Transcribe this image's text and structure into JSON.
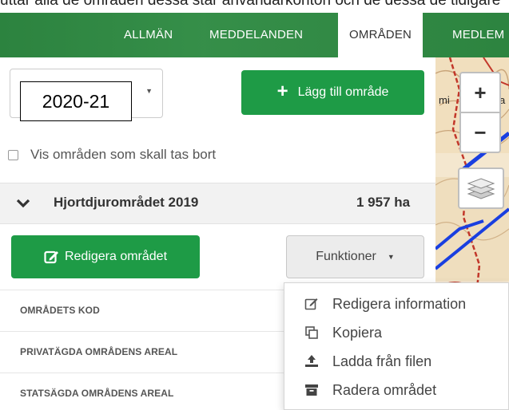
{
  "page_top_strip_text": "uttar alla de områden dessa står användarkonton och de dessa de tidigare",
  "nav": {
    "tabs": [
      {
        "label": "ALLMÄN",
        "active": false
      },
      {
        "label": "MEDDELANDEN",
        "active": false
      },
      {
        "label": "OMRÅDEN",
        "active": true
      },
      {
        "label": "MEDLEM",
        "active": false
      }
    ]
  },
  "sidebar": {
    "season_select": {
      "value": "2020-21"
    },
    "add_area_label": "Lägg till område",
    "show_deleted_label": "Vis områden som skall tas bort",
    "area": {
      "name": "Hjortdjurområdet 2019",
      "size": "1 957 ha"
    },
    "edit_area_label": "Redigera området",
    "functions_label": "Funktioner",
    "info_rows": [
      "OMRÅDETS KOD",
      "PRIVATÄGDA OMRÅDENS AREAL",
      "STATSÄGDA OMRÅDENS AREAL"
    ]
  },
  "functions_menu": {
    "items": [
      {
        "label": "Redigera information",
        "icon": "edit-icon"
      },
      {
        "label": "Kopiera",
        "icon": "copy-icon"
      },
      {
        "label": "Ladda från filen",
        "icon": "upload-icon"
      },
      {
        "label": "Radera området",
        "icon": "archive-icon"
      }
    ]
  },
  "map": {
    "zoom_in": "+",
    "zoom_out": "−",
    "map_label_fragment": "mi",
    "map_label_fragment2": "a"
  },
  "colors": {
    "nav_green": "#2f8b43",
    "button_green": "#1e9b46",
    "map_route_blue": "#1a3fe0",
    "map_route_red": "#c2372a"
  }
}
